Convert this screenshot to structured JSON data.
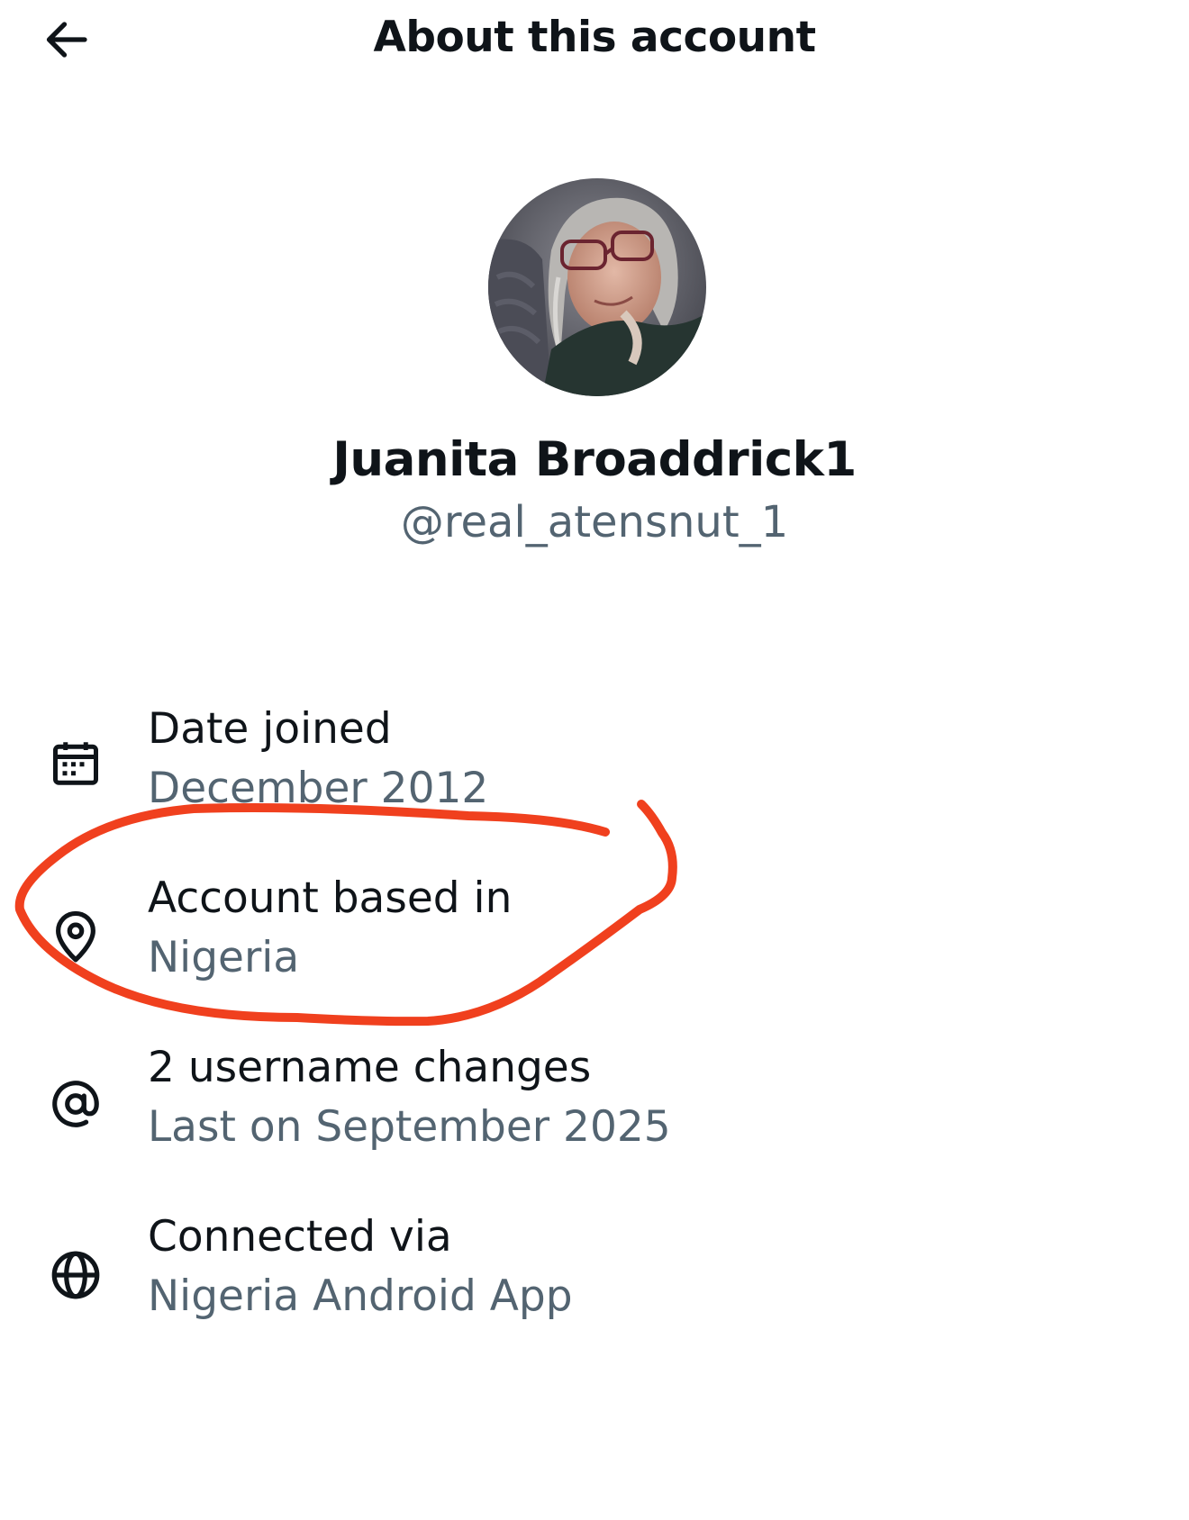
{
  "header": {
    "title": "About this account",
    "back_icon": "arrow-left-icon"
  },
  "profile": {
    "display_name": "Juanita Broaddrick1",
    "handle": "@real_atensnut_1",
    "avatar": "profile-photo"
  },
  "info": [
    {
      "icon": "calendar-icon",
      "label": "Date joined",
      "value": "December 2012"
    },
    {
      "icon": "location-pin-icon",
      "label": "Account based in",
      "value": "Nigeria"
    },
    {
      "icon": "at-sign-icon",
      "label": "2 username changes",
      "value": "Last on September 2025"
    },
    {
      "icon": "globe-icon",
      "label": "Connected via",
      "value": "Nigeria Android App"
    }
  ],
  "colors": {
    "text_primary": "#0f1419",
    "text_secondary": "#536471",
    "annotation": "#f0401e"
  }
}
